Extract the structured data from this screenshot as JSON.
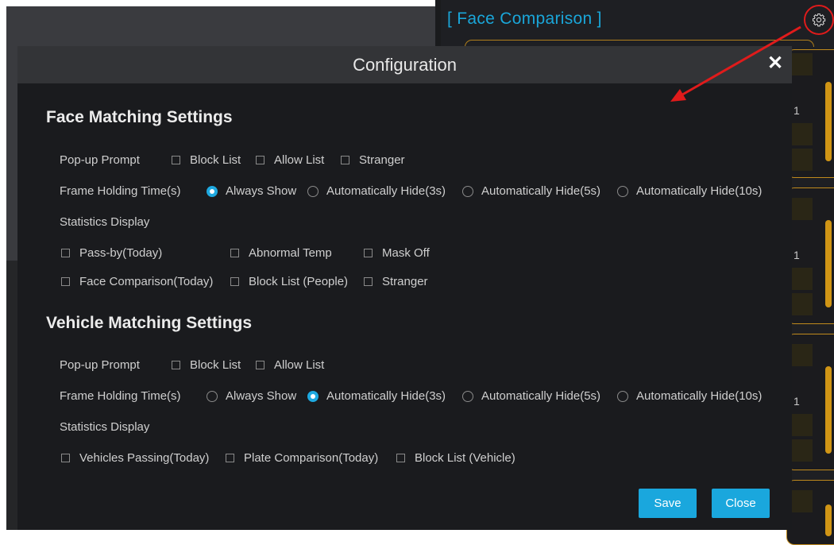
{
  "background": {
    "panel_title": "[ Face Comparison ]",
    "card_number": "1"
  },
  "dialog": {
    "title": "Configuration",
    "close_glyph": "✕",
    "face_section": {
      "title": "Face Matching Settings",
      "popup_label": "Pop-up Prompt",
      "popup_options": [
        "Block List",
        "Allow List",
        "Stranger"
      ],
      "holding_label": "Frame Holding Time(s)",
      "holding_options": [
        "Always Show",
        "Automatically Hide(3s)",
        "Automatically Hide(5s)",
        "Automatically Hide(10s)"
      ],
      "holding_selected": "Always Show",
      "stats_label": "Statistics Display",
      "stats_options": [
        "Pass-by(Today)",
        "Abnormal Temp",
        "Mask Off",
        "Face Comparison(Today)",
        "Block List (People)",
        "Stranger"
      ]
    },
    "vehicle_section": {
      "title": "Vehicle Matching Settings",
      "popup_label": "Pop-up Prompt",
      "popup_options": [
        "Block List",
        "Allow List"
      ],
      "holding_label": "Frame Holding Time(s)",
      "holding_options": [
        "Always Show",
        "Automatically Hide(3s)",
        "Automatically Hide(5s)",
        "Automatically Hide(10s)"
      ],
      "holding_selected": "Automatically Hide(3s)",
      "stats_label": "Statistics Display",
      "stats_options": [
        "Vehicles Passing(Today)",
        "Plate Comparison(Today)",
        "Block List (Vehicle)"
      ]
    },
    "save_label": "Save",
    "close_label": "Close"
  },
  "colors": {
    "accent": "#1aa7dd",
    "dialog_bg": "#1a1b1e",
    "header_bg": "#333437",
    "highlight_red": "#e01b1b",
    "card_gold": "#d09515"
  }
}
